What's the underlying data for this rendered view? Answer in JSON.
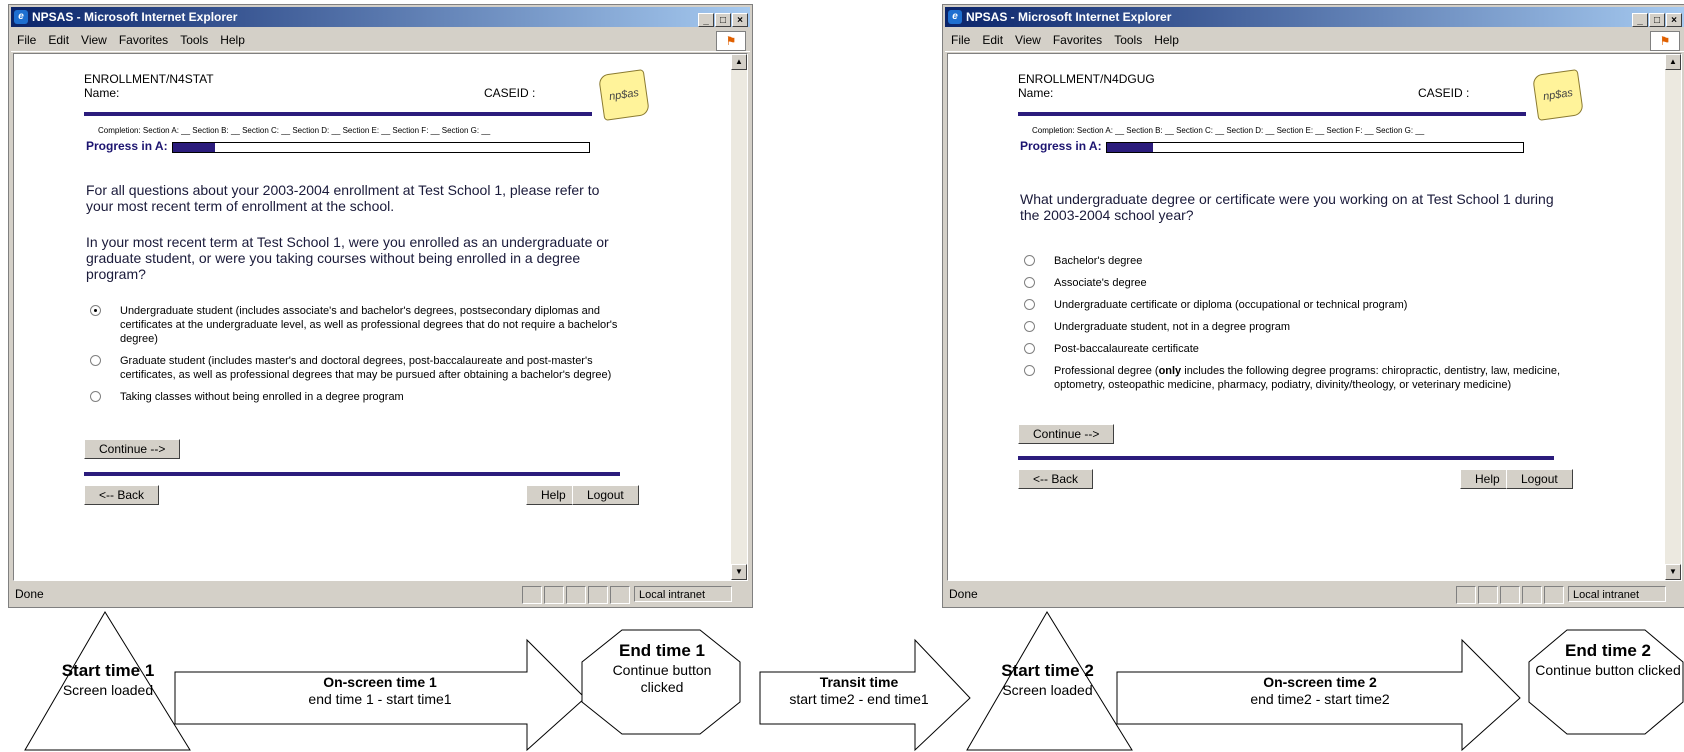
{
  "window1": {
    "title": "NPSAS - Microsoft Internet Explorer",
    "menu": [
      "File",
      "Edit",
      "View",
      "Favorites",
      "Tools",
      "Help"
    ],
    "page_id": "ENROLLMENT/N4STAT",
    "name_label": "Name:",
    "caseid_label": "CASEID :",
    "logo_text": "np$as",
    "completion": "Completion:  Section A: __  Section B: __  Section C: __  Section D: __  Section E: __  Section F: __  Section G: __",
    "progress_label": "Progress in A:",
    "progress_fraction": 0.1,
    "intro": "For all questions about your 2003-2004 enrollment at Test School 1, please refer to your most recent term of enrollment at the school.",
    "question": "In your most recent term at Test School 1, were you enrolled as an undergraduate or graduate student, or were you taking courses without being enrolled in a degree program?",
    "options": [
      {
        "label": "Undergraduate student (includes associate's and bachelor's degrees, postsecondary diplomas and certificates at the undergraduate level, as well as professional degrees that do not require a bachelor's degree)",
        "selected": true
      },
      {
        "label": "Graduate student (includes master's and doctoral degrees, post-baccalaureate and post-master's certificates, as well as professional degrees that may be pursued after obtaining a bachelor's degree)",
        "selected": false
      },
      {
        "label": "Taking classes without being enrolled in a degree program",
        "selected": false
      }
    ],
    "continue_label": "Continue -->",
    "back_label": "<-- Back",
    "help_label": "Help",
    "logout_label": "Logout",
    "status": "Done",
    "zone": "Local intranet"
  },
  "window2": {
    "title": "NPSAS - Microsoft Internet Explorer",
    "menu": [
      "File",
      "Edit",
      "View",
      "Favorites",
      "Tools",
      "Help"
    ],
    "page_id": "ENROLLMENT/N4DGUG",
    "name_label": "Name:",
    "caseid_label": "CASEID :",
    "logo_text": "np$as",
    "completion": "Completion:  Section A: __  Section B: __  Section C: __  Section D: __  Section E: __  Section F: __  Section G: __",
    "progress_label": "Progress in A:",
    "progress_fraction": 0.11,
    "question": "What undergraduate degree or certificate were you working on at Test School 1 during the 2003-2004 school year?",
    "options": [
      {
        "label": "Bachelor's degree",
        "selected": false
      },
      {
        "label": "Associate's degree",
        "selected": false
      },
      {
        "label": "Undergraduate certificate or diploma (occupational or technical program)",
        "selected": false
      },
      {
        "label": "Undergraduate student, not in a degree program",
        "selected": false
      },
      {
        "label": "Post-baccalaureate certificate",
        "selected": false
      }
    ],
    "option6_pre": "Professional degree (",
    "option6_bold": "only",
    "option6_post": " includes the following degree programs: chiropractic, dentistry, law, medicine, optometry, osteopathic medicine, pharmacy, podiatry, divinity/theology, or veterinary medicine)",
    "continue_label": "Continue -->",
    "back_label": "<-- Back",
    "help_label": "Help",
    "logout_label": "Logout",
    "status": "Done",
    "zone": "Local intranet"
  },
  "diagram": {
    "start1_title": "Start time 1",
    "start1_sub": "Screen loaded",
    "onscreen1_title": "On-screen time 1",
    "onscreen1_sub": "end time 1 - start time1",
    "end1_title": "End time 1",
    "end1_sub": "Continue button clicked",
    "transit_title": "Transit time",
    "transit_sub": "start time2 - end time1",
    "start2_title": "Start time 2",
    "start2_sub": "Screen loaded",
    "onscreen2_title": "On-screen time 2",
    "onscreen2_sub": "end time2 - start time2",
    "end2_title": "End time 2",
    "end2_sub": "Continue button clicked"
  }
}
